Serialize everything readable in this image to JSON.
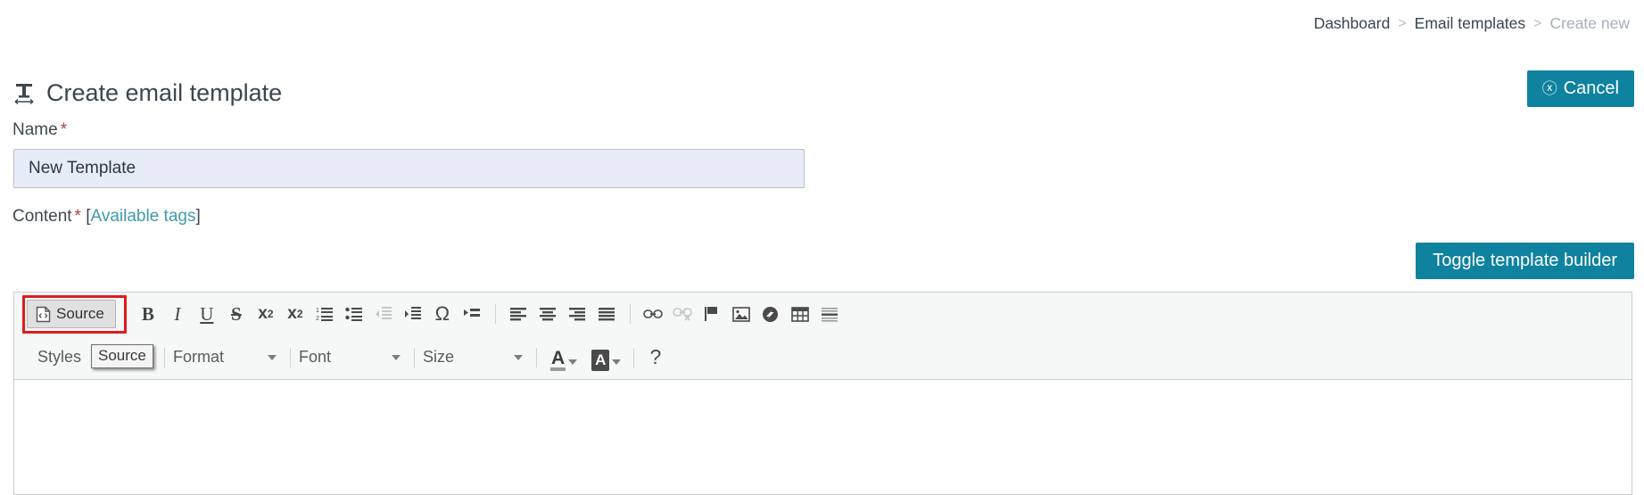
{
  "breadcrumb": {
    "items": [
      {
        "label": "Dashboard",
        "current": false
      },
      {
        "label": "Email templates",
        "current": false
      },
      {
        "label": "Create new",
        "current": true
      }
    ],
    "separator": ">"
  },
  "header": {
    "title": "Create email template",
    "icon": "text-format-icon",
    "cancel_label": "Cancel",
    "cancel_icon": "circle-x-icon",
    "accent_color": "#0f82a0"
  },
  "form": {
    "name_label": "Name",
    "required_mark": "*",
    "name_value": "New Template",
    "name_placeholder": "",
    "content_label": "Content",
    "content_tags_open": "[",
    "content_tags_link": "Available tags",
    "content_tags_close": "]",
    "toggle_builder_label": "Toggle template builder",
    "link_color": "#3f9aad",
    "input_background": "#e7ecf8"
  },
  "editor": {
    "highlight_color": "#e01b1b",
    "tooltip": "Source",
    "source_button": {
      "label": "Source",
      "icon": "source-code-document-icon",
      "active": true
    },
    "toolbar_row1": [
      {
        "name": "bold-icon",
        "glyph": "B",
        "disabled": false
      },
      {
        "name": "italic-icon",
        "glyph": "I",
        "disabled": false
      },
      {
        "name": "underline-icon",
        "glyph": "U",
        "disabled": false
      },
      {
        "name": "strikethrough-icon",
        "glyph": "S",
        "disabled": false
      },
      {
        "name": "subscript-icon",
        "glyph": "x₂",
        "disabled": false
      },
      {
        "name": "superscript-icon",
        "glyph": "x²",
        "disabled": false
      },
      {
        "name": "numbered-list-icon",
        "glyph": "",
        "disabled": false
      },
      {
        "name": "bulleted-list-icon",
        "glyph": "",
        "disabled": false
      },
      {
        "name": "decrease-indent-icon",
        "glyph": "",
        "disabled": true
      },
      {
        "name": "increase-indent-icon",
        "glyph": "",
        "disabled": false
      },
      {
        "name": "special-character-icon",
        "glyph": "Ω",
        "disabled": false
      },
      {
        "name": "blockquote-icon",
        "glyph": "",
        "disabled": false
      },
      {
        "name": "align-left-icon",
        "glyph": "",
        "disabled": false
      },
      {
        "name": "align-center-icon",
        "glyph": "",
        "disabled": false
      },
      {
        "name": "align-right-icon",
        "glyph": "",
        "disabled": false
      },
      {
        "name": "align-justify-icon",
        "glyph": "",
        "disabled": false
      },
      {
        "name": "link-icon",
        "glyph": "",
        "disabled": false
      },
      {
        "name": "unlink-icon",
        "glyph": "",
        "disabled": true
      },
      {
        "name": "anchor-flag-icon",
        "glyph": "",
        "disabled": false
      },
      {
        "name": "image-icon",
        "glyph": "",
        "disabled": false
      },
      {
        "name": "flash-icon",
        "glyph": "",
        "disabled": false
      },
      {
        "name": "table-icon",
        "glyph": "",
        "disabled": false
      },
      {
        "name": "horizontal-rule-icon",
        "glyph": "",
        "disabled": false
      }
    ],
    "toolbar_row2": {
      "styles_label": "Styles",
      "format_label": "Format",
      "font_label": "Font",
      "size_label": "Size",
      "text_color_glyph": "A",
      "background_color_glyph": "A",
      "help_glyph": "?"
    },
    "content_value": ""
  }
}
